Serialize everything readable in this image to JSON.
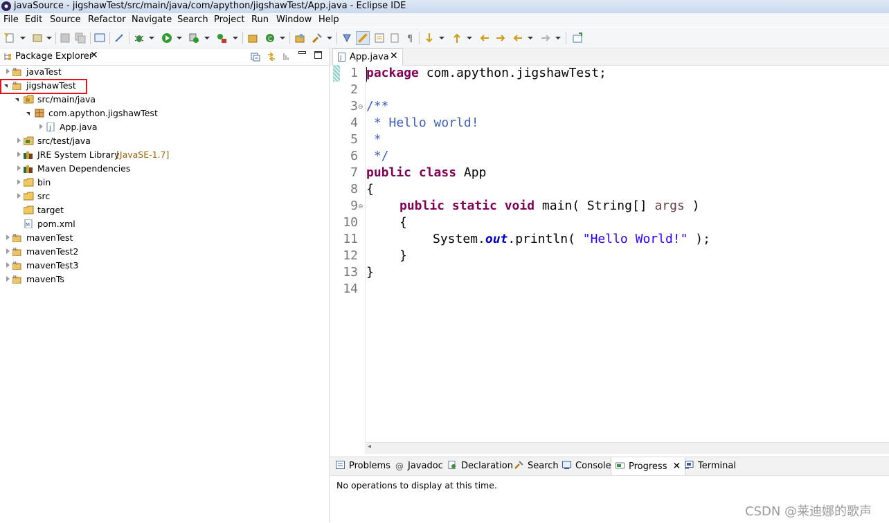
{
  "window": {
    "title": "javaSource - jigshawTest/src/main/java/com/apython/jigshawTest/App.java - Eclipse IDE"
  },
  "menubar": {
    "items": [
      "File",
      "Edit",
      "Source",
      "Refactor",
      "Navigate",
      "Search",
      "Project",
      "Run",
      "Window",
      "Help"
    ]
  },
  "package_explorer": {
    "tab_label": "Package Explorer",
    "tree": [
      {
        "label": "javaTest",
        "icon": "maven-project-icon"
      },
      {
        "label": "jigshawTest",
        "icon": "maven-project-icon"
      },
      {
        "label": "src/main/java",
        "icon": "source-folder-icon"
      },
      {
        "label": "com.apython.jigshawTest",
        "icon": "package-icon"
      },
      {
        "label": "App.java",
        "icon": "java-file-icon"
      },
      {
        "label": "src/test/java",
        "icon": "source-folder-icon"
      },
      {
        "label": "JRE System Library",
        "decoration": "[JavaSE-1.7]",
        "icon": "library-icon"
      },
      {
        "label": "Maven Dependencies",
        "icon": "library-icon"
      },
      {
        "label": "bin",
        "icon": "folder-icon"
      },
      {
        "label": "src",
        "icon": "folder-icon"
      },
      {
        "label": "target",
        "icon": "folder-icon"
      },
      {
        "label": "pom.xml",
        "icon": "xml-file-icon"
      },
      {
        "label": "mavenTest",
        "icon": "maven-project-icon"
      },
      {
        "label": "mavenTest2",
        "icon": "maven-project-icon"
      },
      {
        "label": "mavenTest3",
        "icon": "maven-project-icon"
      },
      {
        "label": "mavenTs",
        "icon": "maven-project-icon"
      }
    ]
  },
  "editor": {
    "tab_label": "App.java",
    "line_numbers": [
      "1",
      "2",
      "3",
      "4",
      "5",
      "6",
      "7",
      "8",
      "9",
      "10",
      "11",
      "12",
      "13",
      "14"
    ],
    "code": {
      "l1_kw": "package",
      "l1_rest": " com.apython.jigshawTest;",
      "l3": "/**",
      "l4": " * Hello world!",
      "l5": " *",
      "l6": " */",
      "l7_kw": "public class",
      "l7_rest": " App",
      "l8": "{",
      "l9_kw": "public static void",
      "l9_mid": " main( String[] ",
      "l9_param": "args",
      "l9_end": " )",
      "l10": "{",
      "l11_pre": "System.",
      "l11_field": "out",
      "l11_mid": ".println( ",
      "l11_str": "\"Hello World!\"",
      "l11_end": " );",
      "l12": "}",
      "l13": "}"
    }
  },
  "bottom_panel": {
    "tabs": [
      "Problems",
      "Javadoc",
      "Declaration",
      "Search",
      "Console",
      "Progress",
      "Terminal"
    ],
    "message": "No operations to display at this time."
  },
  "watermark": "CSDN @莱迪娜的歌声",
  "colors": {
    "keyword": "#7f0055",
    "comment": "#3f5fbf",
    "string": "#2a00ff",
    "highlight_box": "#e0141a"
  }
}
